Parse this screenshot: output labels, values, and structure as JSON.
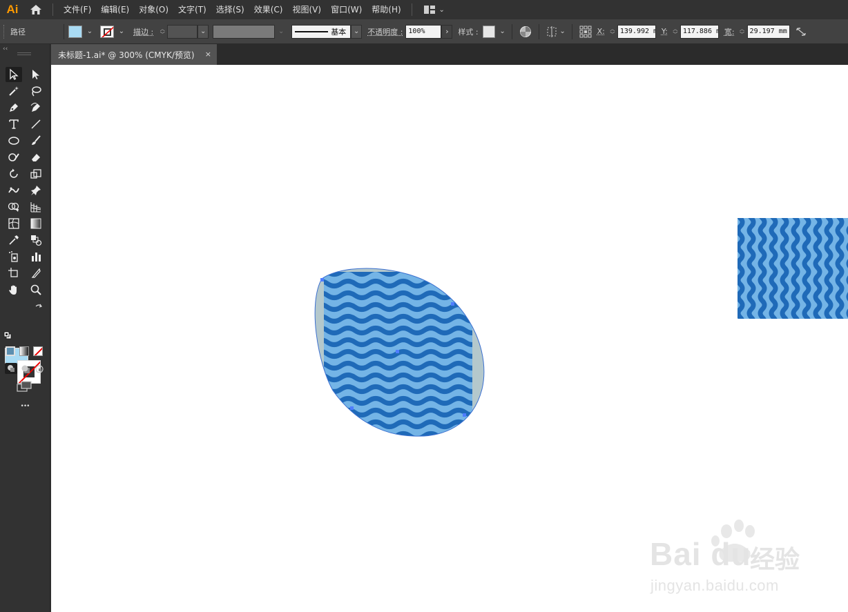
{
  "app": {
    "logo": "Ai"
  },
  "menu": {
    "items": [
      "文件(F)",
      "编辑(E)",
      "对象(O)",
      "文字(T)",
      "选择(S)",
      "效果(C)",
      "视图(V)",
      "窗口(W)",
      "帮助(H)"
    ]
  },
  "control": {
    "object_type": "路径",
    "stroke_label": "描边 :",
    "brush_label": "基本",
    "opacity_label": "不透明度 :",
    "opacity_value": "100%",
    "style_label": "样式 :",
    "x_label": "X:",
    "x_value": "139.992 m",
    "y_label": "Y:",
    "y_value": "117.886 m",
    "w_label": "宽:",
    "w_value": "29.197 mm",
    "colors": {
      "fill": "#a9dbf4",
      "stroke": "none"
    }
  },
  "document": {
    "tab_title": "未标题-1.ai* @ 300% (CMYK/预览)",
    "close_glyph": "×"
  },
  "toolbar": {
    "more_label": "•••",
    "fill_color": "#a9dbf4",
    "stroke_color": "none"
  },
  "pattern": {
    "dark_blue": "#1f6ab8",
    "light_blue": "#74b4e6",
    "gray": "#b4c8cc"
  },
  "watermark": {
    "brand": "Bai du",
    "cn": "经验",
    "url": "jingyan.baidu.com"
  }
}
